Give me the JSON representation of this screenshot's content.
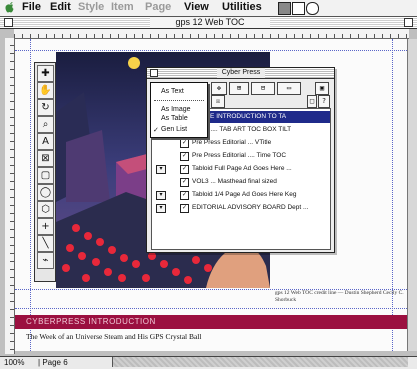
{
  "menubar": {
    "items": [
      "File",
      "Edit",
      "Style",
      "Item",
      "Page",
      "View",
      "Utilities"
    ]
  },
  "document": {
    "title": "gps 12 Web TOC"
  },
  "palette": {
    "title": "Cyber Press",
    "popup_items": [
      "As Text",
      "As Image",
      "As Table",
      "Gen List"
    ],
    "rows": [
      {
        "label": "NCASE INTRODUCTION TO TA",
        "checked": true,
        "selected": true,
        "expander": false
      },
      {
        "label": "VOL3 .... TAB ART TOC BOX TILT",
        "checked": true,
        "selected": false,
        "expander": true
      },
      {
        "label": "Pre Press Editorial ... VTitle",
        "checked": true,
        "selected": false,
        "expander": false
      },
      {
        "label": "Pre Press Editorial .... Time TOC",
        "checked": true,
        "selected": false,
        "expander": false
      },
      {
        "label": "Tabloid Full Page Ad Goes Here ...",
        "checked": true,
        "selected": false,
        "expander": true
      },
      {
        "label": "VOL3 ... Masthead final sized",
        "checked": true,
        "selected": false,
        "expander": false
      },
      {
        "label": "Tabloid 1/4 Page Ad Goes Here Keg",
        "checked": true,
        "selected": false,
        "expander": true
      },
      {
        "label": "EDITORIAL ADVISORY BOARD Dept ...",
        "checked": true,
        "selected": false,
        "expander": true
      }
    ]
  },
  "page": {
    "credit": "gps 12 Web TOC credit line — Dustin Shepherd Cecily C. Shorbuck",
    "band_text": "CYBERPRESS INTRODUCTION",
    "subtitle": "The Week of an Universe Steam and His GPS Crystal Ball"
  },
  "status": {
    "zoom": "100%",
    "page": "Page 6"
  },
  "colors": {
    "band": "#9b1040",
    "selection": "#1f2a8a",
    "guides": "#5a66c8"
  }
}
